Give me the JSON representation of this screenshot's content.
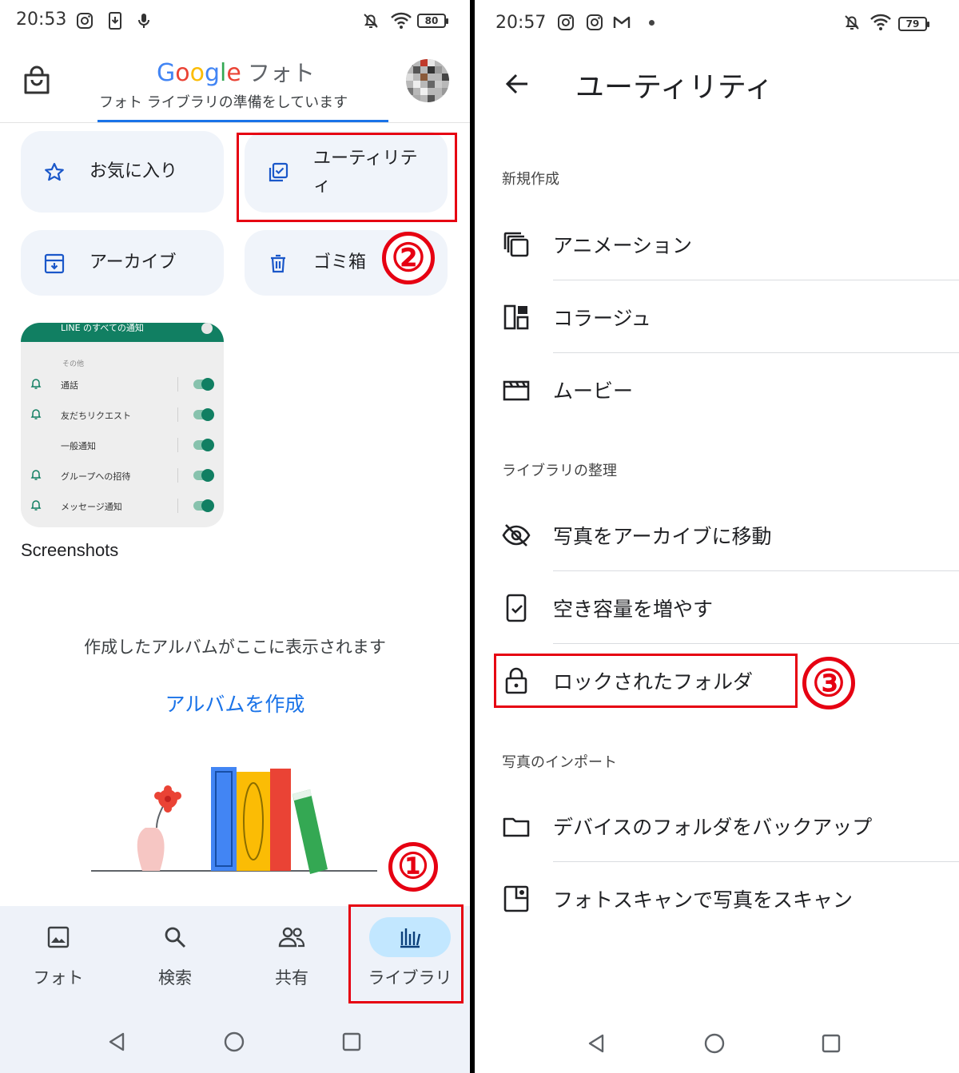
{
  "left": {
    "status": {
      "time": "20:53",
      "battery": "80"
    },
    "header": {
      "brand": [
        "G",
        "o",
        "o",
        "g",
        "l",
        "e"
      ],
      "app_suffix": "フォト",
      "subtitle": "フォト ライブラリの準備をしています"
    },
    "chips": {
      "favorites": "お気に入り",
      "utilities_line1": "ユーティリテ",
      "utilities_line2": "ィ",
      "archive": "アーカイブ",
      "trash": "ゴミ箱"
    },
    "album_card": {
      "top_text": "LINE のすべての通知",
      "section": "その他",
      "rows": [
        "通話",
        "友だちリクエスト",
        "一般通知",
        "グループへの招待",
        "メッセージ通知"
      ]
    },
    "album_name": "Screenshots",
    "empty_text": "作成したアルバムがここに表示されます",
    "create_link": "アルバムを作成",
    "nav": {
      "photos": "フォト",
      "search": "検索",
      "sharing": "共有",
      "library": "ライブラリ"
    },
    "annotations": {
      "step1": "①",
      "step2": "②"
    }
  },
  "right": {
    "status": {
      "time": "20:57",
      "battery": "79"
    },
    "title": "ユーティリティ",
    "sections": {
      "create_new": "新規作成",
      "organize": "ライブラリの整理",
      "import": "写真のインポート"
    },
    "items": {
      "animation": "アニメーション",
      "collage": "コラージュ",
      "movie": "ムービー",
      "archive_move": "写真をアーカイブに移動",
      "free_space": "空き容量を増やす",
      "locked_folder": "ロックされたフォルダ",
      "backup_device_folders": "デバイスのフォルダをバックアップ",
      "photoscan": "フォトスキャンで写真をスキャン"
    },
    "annotations": {
      "step3": "③"
    }
  },
  "colors": {
    "annotation_red": "#e60012",
    "accent_blue": "#1a73e8",
    "active_pill": "#c2e7ff"
  }
}
